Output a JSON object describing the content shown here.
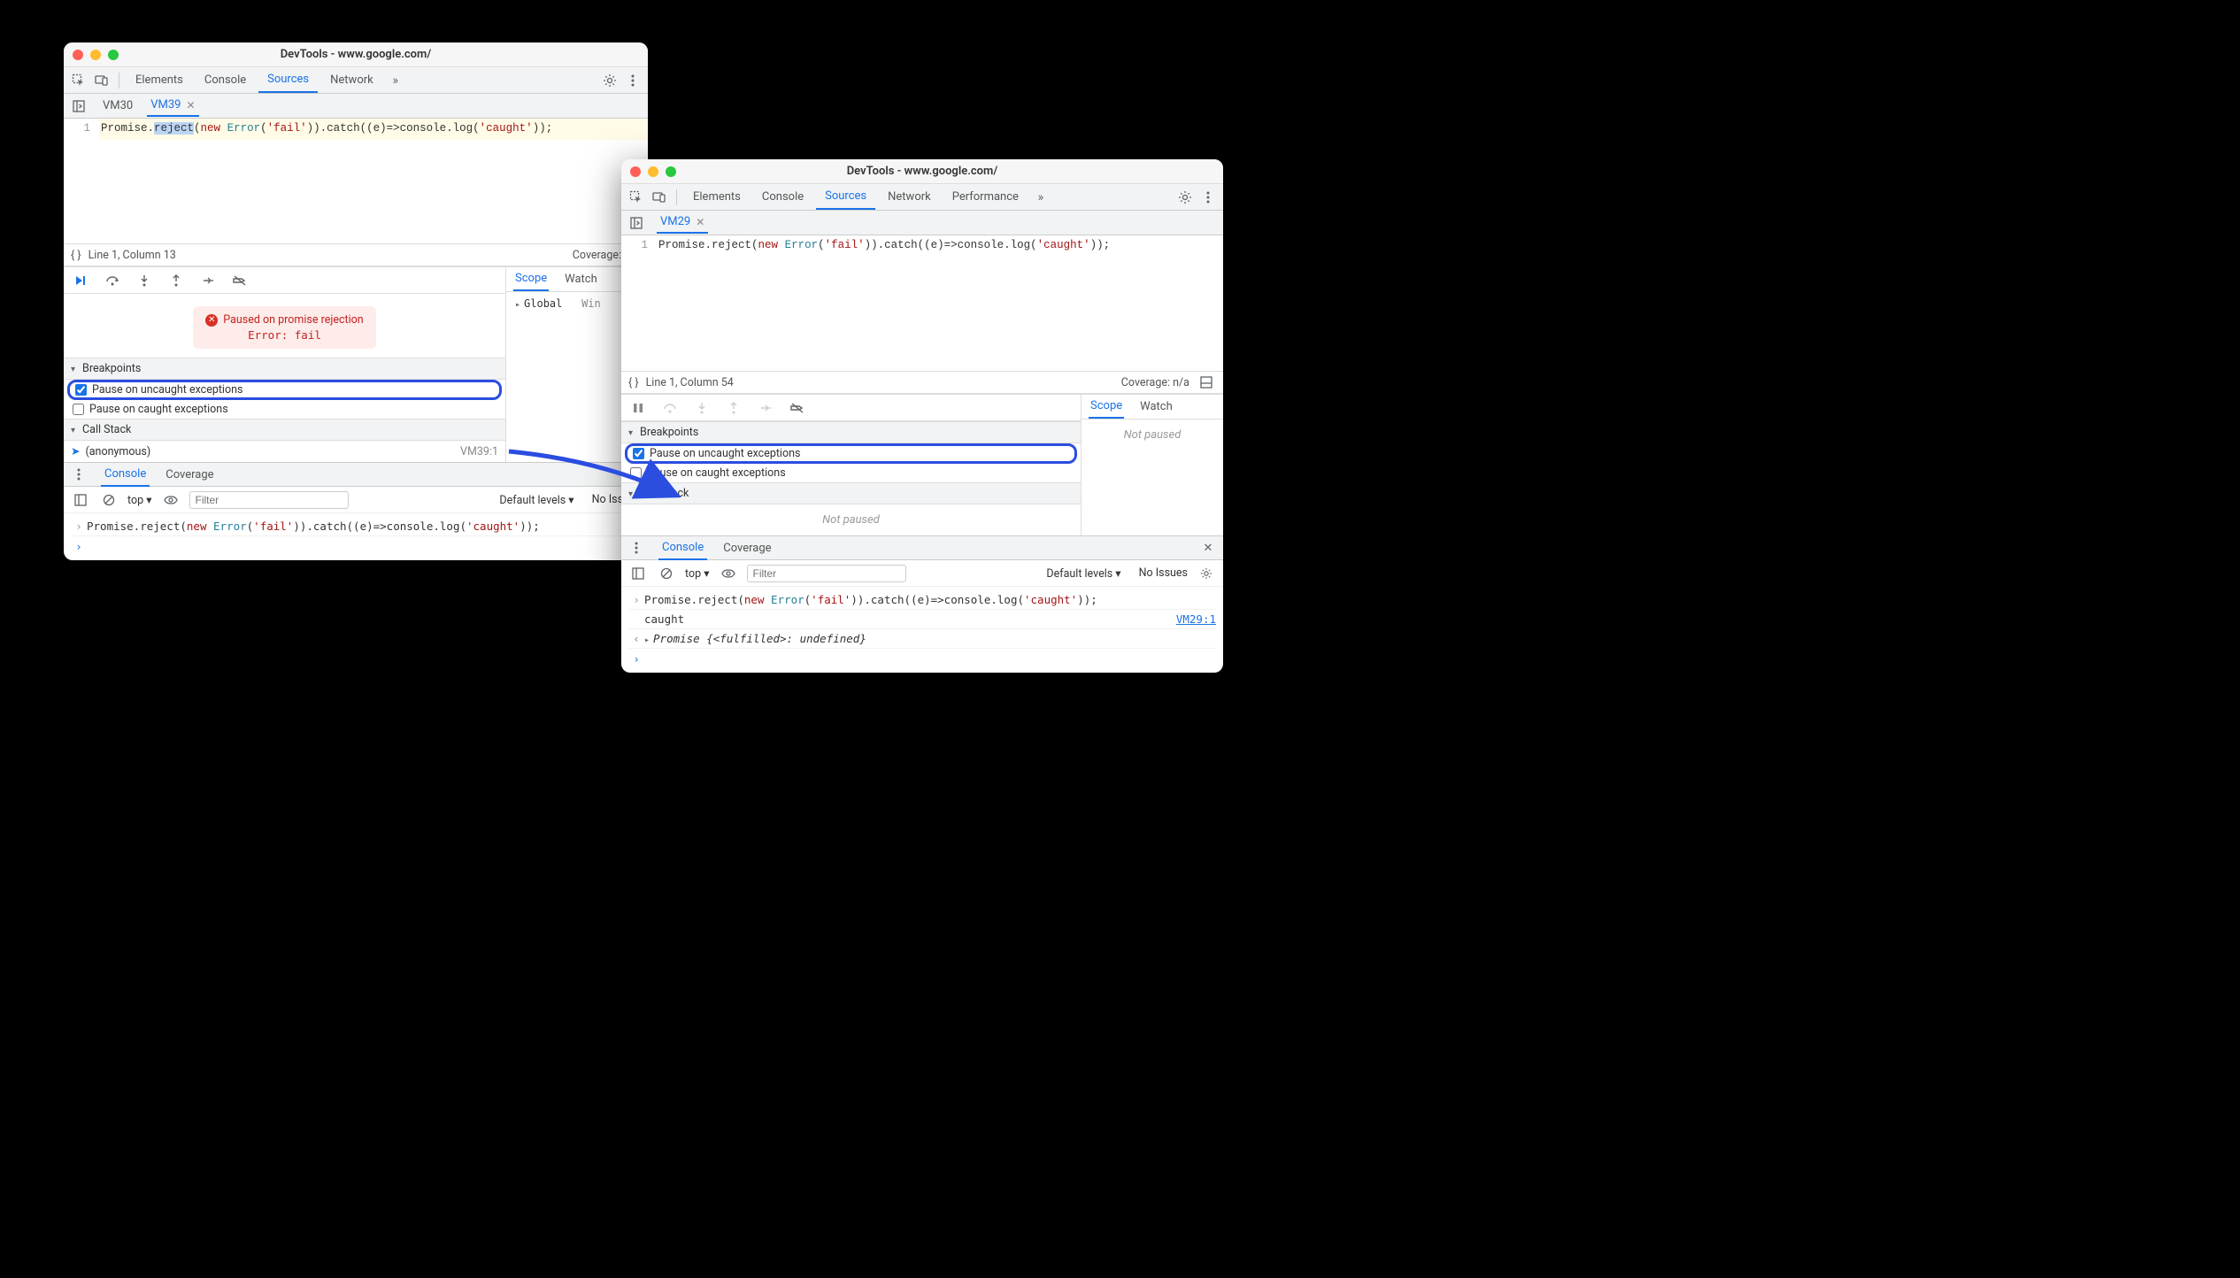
{
  "windowA": {
    "title": "DevTools - www.google.com/",
    "mainTabs": [
      "Elements",
      "Console",
      "Sources",
      "Network"
    ],
    "activeMainTab": "Sources",
    "fileTabs": [
      {
        "name": "VM30",
        "active": false
      },
      {
        "name": "VM39",
        "active": true
      }
    ],
    "lineNumber": "1",
    "code": {
      "a": "Promise.",
      "sel": "reject",
      "b": "(",
      "new": "new",
      "sp": " ",
      "cls": "Error",
      "c": "(",
      "str1": "'fail'",
      "d": ")).catch((e)=>console.log(",
      "str2": "'caught'",
      "e": "));"
    },
    "statusLeft": "Line 1, Column 13",
    "statusCoverage": "Coverage: n/a",
    "scopeTabs": [
      "Scope",
      "Watch"
    ],
    "scopeActive": "Scope",
    "scope": {
      "global": "Global",
      "win": "Win"
    },
    "pauseMsg": "Paused on promise rejection",
    "pauseErr": "Error: fail",
    "breakpointsHeader": "Breakpoints",
    "bpUncaught": "Pause on uncaught exceptions",
    "bpCaught": "Pause on caught exceptions",
    "callStackHeader": "Call Stack",
    "callStack": [
      {
        "name": "(anonymous)",
        "loc": "VM39:1"
      }
    ],
    "drawerTabs": [
      "Console",
      "Coverage"
    ],
    "drawerActive": "Console",
    "consoleContext": "top",
    "filterPlaceholder": "Filter",
    "defaultLevels": "Default levels",
    "noIssues": "No Issues",
    "consoleInputCode": {
      "a": "Promise.reject(",
      "new": "new",
      "sp": " ",
      "cls": "Error",
      "b": "(",
      "str1": "'fail'",
      "c": ")).catch((e)=>console.log(",
      "str2": "'caught'",
      "d": "));"
    }
  },
  "windowB": {
    "title": "DevTools - www.google.com/",
    "mainTabs": [
      "Elements",
      "Console",
      "Sources",
      "Network",
      "Performance"
    ],
    "activeMainTab": "Sources",
    "fileTabs": [
      {
        "name": "VM29",
        "active": true
      }
    ],
    "lineNumber": "1",
    "code": {
      "a": "Promise.reject(",
      "new": "new",
      "sp": " ",
      "cls": "Error",
      "b": "(",
      "str1": "'fail'",
      "c": ")).catch((e)=>console.log(",
      "str2": "'caught'",
      "d": "));"
    },
    "statusLeft": "Line 1, Column 54",
    "statusCoverage": "Coverage: n/a",
    "scopeTabs": [
      "Scope",
      "Watch"
    ],
    "scopeActive": "Scope",
    "notPausedScope": "Not paused",
    "breakpointsHeader": "Breakpoints",
    "bpUncaught": "Pause on uncaught exceptions",
    "bpCaught": "Pause on caught exceptions",
    "callStackHeader": "Call Stack",
    "notPausedCS": "Not paused",
    "drawerTabs": [
      "Console",
      "Coverage"
    ],
    "drawerActive": "Console",
    "consoleContext": "top",
    "filterPlaceholder": "Filter",
    "defaultLevels": "Default levels",
    "noIssues": "No Issues",
    "consoleRows": {
      "input": {
        "a": "Promise.reject(",
        "new": "new",
        "sp": " ",
        "cls": "Error",
        "b": "(",
        "str1": "'fail'",
        "c": ")).catch((e)=>console.log(",
        "str2": "'caught'",
        "d": "));"
      },
      "log": "caught",
      "logSource": "VM29:1",
      "result": "Promise {<fulfilled>: undefined}"
    }
  }
}
